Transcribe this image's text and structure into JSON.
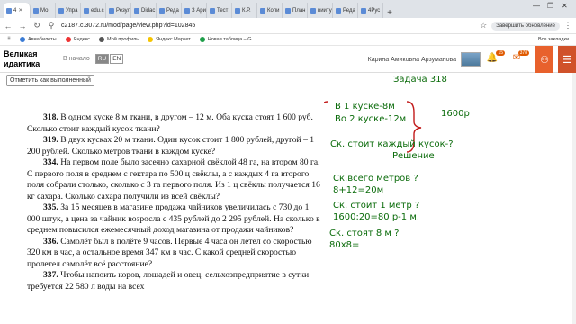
{
  "browser": {
    "tabs": [
      {
        "label": "4",
        "active": true
      },
      {
        "label": "Мо"
      },
      {
        "label": "Упра"
      },
      {
        "label": "edu.c"
      },
      {
        "label": "Резул"
      },
      {
        "label": "Didac"
      },
      {
        "label": "Реда"
      },
      {
        "label": "З Ари"
      },
      {
        "label": "Тест"
      },
      {
        "label": "К.Р."
      },
      {
        "label": "Копи"
      },
      {
        "label": "План"
      },
      {
        "label": "вииту"
      },
      {
        "label": "Реда"
      },
      {
        "label": "4Рус"
      }
    ],
    "new_tab": "+",
    "url": "c2187.c.3072.ru/mod/page/view.php?id=102845",
    "finish_update": "Завершить обновление",
    "bookmarks": [
      {
        "label": "Авиабилеты",
        "color": "#3a7bd5"
      },
      {
        "label": "Яндекс",
        "color": "#e33"
      },
      {
        "label": "Мой профиль",
        "color": "#555"
      },
      {
        "label": "Яндекс Маркет",
        "color": "#f5c400"
      },
      {
        "label": "Новая таблица – G...",
        "color": "#1e9e49"
      }
    ],
    "all_bookmarks": "Все закладки"
  },
  "site": {
    "logo_line1": "Великая",
    "logo_line2": "идактика",
    "home": "В начало",
    "lang_ru": "RU",
    "lang_en": "EN",
    "username": "Карина Амиковна Арзуманова",
    "notif_count": "15",
    "msg_count": "378",
    "mark_done": "Отметить как выполненный"
  },
  "textbook": [
    {
      "num": "318.",
      "text": "В одном куске 8 м ткани, в другом – 12 м. Оба куска стоят 1 600 руб. Сколько стоит каждый кусок ткани?"
    },
    {
      "num": "319.",
      "text": "В двух кусках 20 м ткани. Один кусок стоит 1 800 рублей, другой – 1 200 рублей. Сколько метров ткани в каждом куске?"
    },
    {
      "num": "334.",
      "text": "На первом поле было засеяно сахарной свёклой 48 га, на втором 80 га. С первого поля в среднем с гектара по 500 ц свёклы, а с каждых 4 га второго поля собрали столько, сколько с 3 га первого поля. Из 1 ц свёклы получается 16 кг сахара. Сколько сахара получили из всей свёклы?"
    },
    {
      "num": "335.",
      "text": "За 15 месяцев в магазине продажа чайников увеличилась с 730 до 1 000 штук, а цена за чайник возросла с 435 рублей до 2 295 рублей. На сколько в среднем повысился ежемесячный доход магазина от продажи чайников?"
    },
    {
      "num": "336.",
      "text": "Самолёт был в полёте 9 часов. Первые 4 часа он летел со скоростью 320 км в час, а остальное время 347 км в час. С какой средней скоростью пролетел самолёт всё расстояние?"
    },
    {
      "num": "337.",
      "text": "Чтобы напоить коров, лошадей и овец, сельхозпредприятие в сутки требуется 22 580 л воды на всех"
    }
  ],
  "board": {
    "title": "Задача 318",
    "line1": "В 1 куске-8м",
    "line2": "Во 2 куске-12м",
    "total": "1600р",
    "question": "Ск. стоит каждый кусок-?",
    "solution": "Решение",
    "step1_q": "Ск.всего метров ?",
    "step1_a": "8+12=20м",
    "step2_q": "Ск. стоит 1 метр ?",
    "step2_a": "1600:20=80 р-1 м.",
    "step3_q": "Ск. стоят 8 м ?",
    "step3_a": "80х8="
  }
}
